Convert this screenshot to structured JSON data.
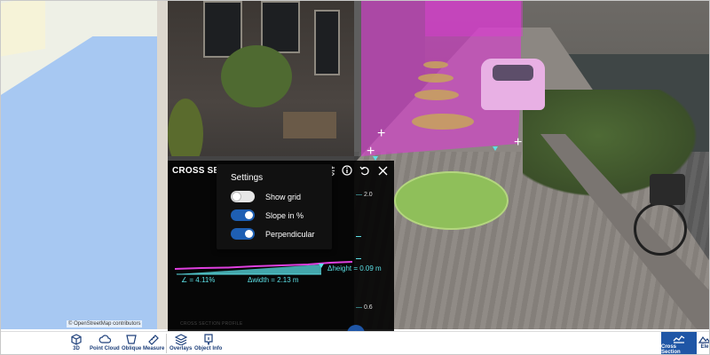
{
  "map": {
    "attribution": "© OpenStreetMap contributors"
  },
  "cross_section": {
    "title": "CROSS SECTION",
    "axis_ticks": [
      "2.0",
      "0.6"
    ],
    "slope_label": "∠ = 4.11%",
    "width_label": "Δwidth = 2.13 m",
    "height_label": "Δheight = 0.09 m",
    "faded_text": "CROSS SECTION PROFILE"
  },
  "settings": {
    "title": "Settings",
    "options": [
      {
        "label": "Show grid",
        "enabled": false
      },
      {
        "label": "Slope in %",
        "enabled": true
      },
      {
        "label": "Perpendicular",
        "enabled": true
      }
    ]
  },
  "toolbar": {
    "items": [
      {
        "label": "3D",
        "icon": "cube-icon"
      },
      {
        "label": "Point Cloud",
        "icon": "cloud-icon"
      },
      {
        "label": "Oblique",
        "icon": "oblique-icon"
      },
      {
        "label": "Measure",
        "icon": "ruler-icon"
      },
      {
        "label": "Overlays",
        "icon": "layers-icon"
      },
      {
        "label": "Object Info",
        "icon": "info-pin-icon"
      }
    ],
    "active": {
      "label": "Cross Section",
      "icon": "cross-section-icon"
    },
    "partial": {
      "label": "Ele",
      "icon": "elevation-icon"
    }
  },
  "colors": {
    "accent": "#1f56a6",
    "measure": "#5ce0e6",
    "overlay": "#dc3cd2",
    "profile_line": "#e040e0"
  }
}
